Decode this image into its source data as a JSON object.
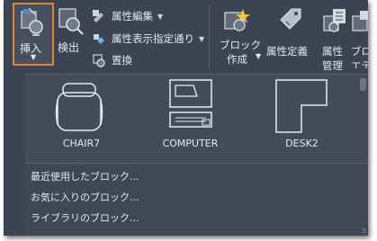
{
  "ribbon": {
    "insert_label": "挿入",
    "detect_label": "検出",
    "attr_edit_label": "属性編集",
    "attr_display_label": "属性表示指定通り",
    "replace_label": "置換",
    "block_create_line1": "ブロック",
    "block_create_line2": "作成",
    "attr_define_label": "属性定義",
    "attr_manage_line1": "属性",
    "attr_manage_line2": "管理",
    "block_editor_line1": "ブロッ",
    "block_editor_line2": "エディ"
  },
  "gallery": {
    "blocks": [
      {
        "name": "CHAIR7"
      },
      {
        "name": "COMPUTER"
      },
      {
        "name": "DESK2"
      }
    ]
  },
  "menu": {
    "recent": "最近使用したブロック...",
    "favorites": "お気に入りのブロック...",
    "library": "ライブラリのブロック..."
  },
  "colors": {
    "background": "#3b4453",
    "accent": "#e2842b",
    "text": "#e6e9ee"
  },
  "icons": [
    "insert-block-icon",
    "detect-icon",
    "attribute-edit-icon",
    "attribute-display-icon",
    "replace-icon",
    "create-block-icon",
    "define-attribute-icon",
    "manage-attributes-icon",
    "block-editor-icon"
  ]
}
